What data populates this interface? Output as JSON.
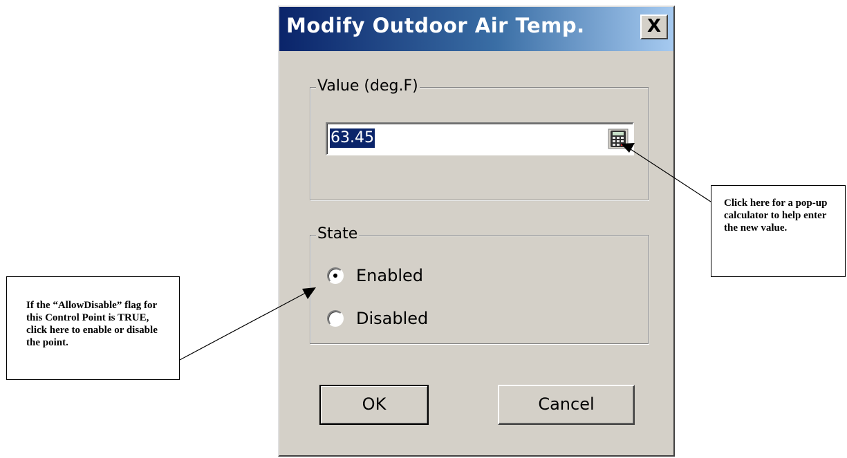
{
  "dialog": {
    "title": "Modify Outdoor Air Temp.",
    "close_label": "X",
    "value_group": {
      "legend": "Value (deg.F)",
      "value": "63.45",
      "calculator_icon": "calculator-icon"
    },
    "state_group": {
      "legend": "State",
      "options": [
        {
          "label": "Enabled",
          "selected": true
        },
        {
          "label": "Disabled",
          "selected": false
        }
      ]
    },
    "ok_label": "OK",
    "cancel_label": "Cancel"
  },
  "annotations": {
    "calculator_note": "Click here for a pop-up calculator to help enter the new value.",
    "state_note": "If the “AllowDisable” flag for this Control Point is TRUE, click here to enable or disable the point."
  },
  "colors": {
    "dialog_face": "#d4d0c8",
    "titlebar_start": "#0a246a",
    "titlebar_end": "#a6caf0",
    "selection": "#0a246a"
  }
}
